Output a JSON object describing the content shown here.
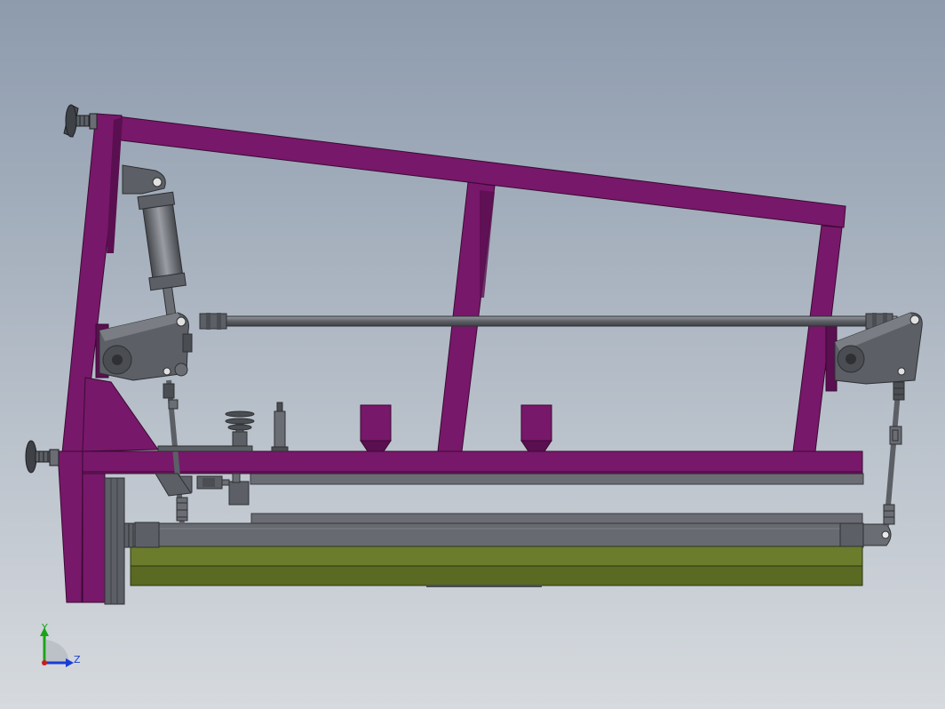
{
  "colors": {
    "background_top": "#8d9bad",
    "background_bottom": "#d6dade",
    "frame_purple": "#78186a",
    "frame_purple_dark": "#5a0f50",
    "steel_gray": "#696d74",
    "steel_dark": "#4a4d52",
    "steel_light": "#8d9096",
    "plate_green": "#5a6a22",
    "plate_green_light": "#6f8030",
    "axis_y": "#1aa31a",
    "axis_z": "#1a3cd4",
    "axis_origin": "#c81e1e"
  },
  "axes": {
    "y_label": "Y",
    "z_label": "Z"
  }
}
